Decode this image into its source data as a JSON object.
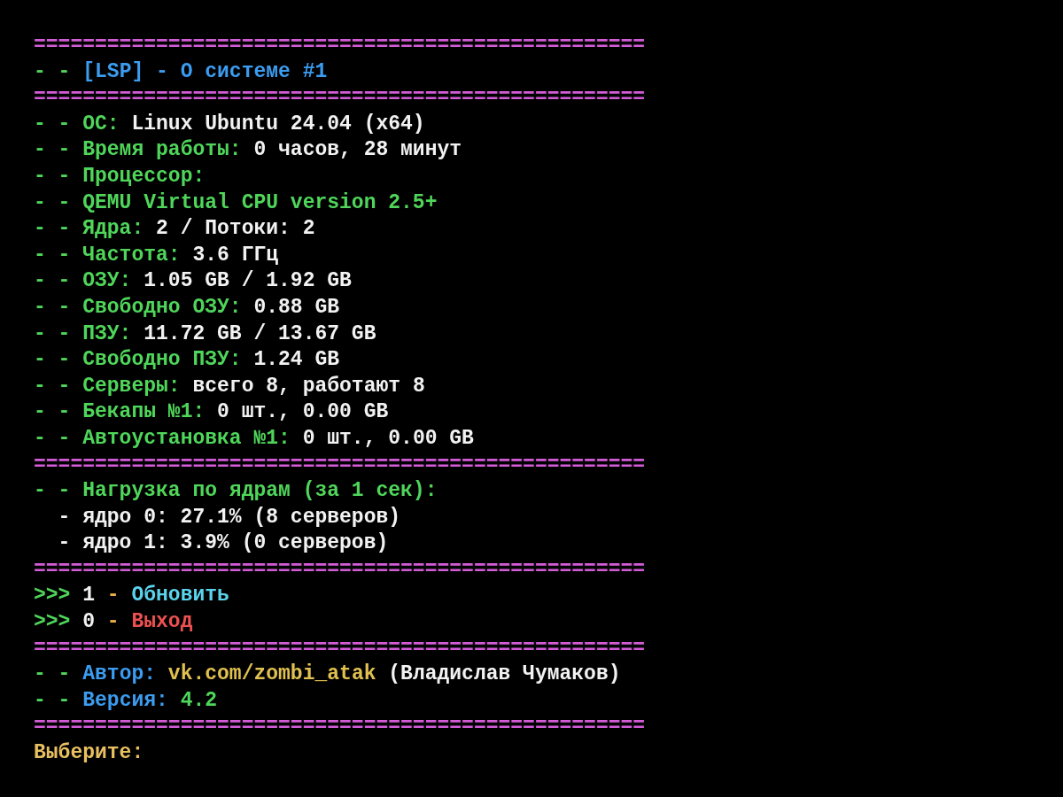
{
  "terminal": {
    "lines": [
      {
        "kind": "rule",
        "text": "=================================================="
      },
      {
        "kind": "text",
        "segments": [
          {
            "kind": "bullet",
            "text": "- -"
          },
          {
            "kind": "heading",
            "text": "[LSP] - О системе #1"
          }
        ]
      },
      {
        "kind": "rule",
        "text": "=================================================="
      },
      {
        "kind": "text",
        "segments": [
          {
            "kind": "label",
            "text": "- - ОС:"
          },
          {
            "kind": "value",
            "text": "Linux Ubuntu 24.04 (x64)"
          }
        ]
      },
      {
        "kind": "text",
        "segments": [
          {
            "kind": "label",
            "text": "- - Время работы:"
          },
          {
            "kind": "value",
            "text": "0 часов, 28 минут"
          }
        ]
      },
      {
        "kind": "text",
        "segments": [
          {
            "kind": "label",
            "text": "- - Процессор:"
          }
        ]
      },
      {
        "kind": "text",
        "segments": [
          {
            "kind": "label",
            "text": "- - QEMU Virtual CPU version 2.5+"
          }
        ]
      },
      {
        "kind": "text",
        "segments": [
          {
            "kind": "label",
            "text": "- - Ядра:"
          },
          {
            "kind": "value",
            "text": "2 / Потоки: 2"
          }
        ]
      },
      {
        "kind": "text",
        "segments": [
          {
            "kind": "label",
            "text": "- - Частота:"
          },
          {
            "kind": "value",
            "text": "3.6 ГГц"
          }
        ]
      },
      {
        "kind": "text",
        "segments": [
          {
            "kind": "label",
            "text": "- - ОЗУ:"
          },
          {
            "kind": "value",
            "text": "1.05 GB / 1.92 GB"
          }
        ]
      },
      {
        "kind": "text",
        "segments": [
          {
            "kind": "label",
            "text": "- - Свободно ОЗУ:"
          },
          {
            "kind": "value",
            "text": "0.88 GB"
          }
        ]
      },
      {
        "kind": "text",
        "segments": [
          {
            "kind": "label",
            "text": "- - ПЗУ:"
          },
          {
            "kind": "value",
            "text": "11.72 GB / 13.67 GB"
          }
        ]
      },
      {
        "kind": "text",
        "segments": [
          {
            "kind": "label",
            "text": "- - Свободно ПЗУ:"
          },
          {
            "kind": "value",
            "text": "1.24 GB"
          }
        ]
      },
      {
        "kind": "text",
        "segments": [
          {
            "kind": "label",
            "text": "- - Серверы:"
          },
          {
            "kind": "value",
            "text": "всего 8, работают 8"
          }
        ]
      },
      {
        "kind": "text",
        "segments": [
          {
            "kind": "label",
            "text": "- - Бекапы №1:"
          },
          {
            "kind": "value",
            "text": "0 шт., 0.00 GB"
          }
        ]
      },
      {
        "kind": "text",
        "segments": [
          {
            "kind": "label",
            "text": "- - Автоустановка №1:"
          },
          {
            "kind": "value",
            "text": "0 шт., 0.00 GB"
          }
        ]
      },
      {
        "kind": "rule",
        "text": "=================================================="
      },
      {
        "kind": "text",
        "segments": [
          {
            "kind": "label",
            "text": "- - Нагрузка по ядрам (за 1 сек):"
          }
        ]
      },
      {
        "kind": "indented",
        "segments": [
          {
            "kind": "value",
            "text": "- ядро 0: 27.1% (8 серверов)"
          }
        ]
      },
      {
        "kind": "indented",
        "segments": [
          {
            "kind": "value",
            "text": "- ядро 1: 3.9% (0 серверов)"
          }
        ]
      },
      {
        "kind": "rule",
        "text": "=================================================="
      },
      {
        "kind": "text",
        "segments": [
          {
            "kind": "arrow",
            "text": ">>>"
          },
          {
            "kind": "value",
            "text": "1"
          },
          {
            "kind": "dash",
            "text": "-"
          },
          {
            "kind": "option",
            "text": "Обновить"
          }
        ]
      },
      {
        "kind": "text",
        "segments": [
          {
            "kind": "arrow",
            "text": ">>>"
          },
          {
            "kind": "value",
            "text": "0"
          },
          {
            "kind": "dash",
            "text": "-"
          },
          {
            "kind": "exit",
            "text": "Выход"
          }
        ]
      },
      {
        "kind": "rule",
        "text": "=================================================="
      },
      {
        "kind": "text",
        "segments": [
          {
            "kind": "bullet",
            "text": "- -"
          },
          {
            "kind": "heading",
            "text": "Автор:"
          },
          {
            "kind": "link",
            "text": "vk.com/zombi_atak"
          },
          {
            "kind": "value",
            "text": "(Владислав Чумаков)"
          }
        ]
      },
      {
        "kind": "text",
        "segments": [
          {
            "kind": "bullet",
            "text": "- -"
          },
          {
            "kind": "heading",
            "text": "Версия:"
          },
          {
            "kind": "label",
            "text": "4.2"
          }
        ]
      },
      {
        "kind": "rule",
        "text": "=================================================="
      },
      {
        "kind": "text",
        "segments": [
          {
            "kind": "prompt",
            "text": "Выберите:"
          }
        ]
      }
    ]
  }
}
